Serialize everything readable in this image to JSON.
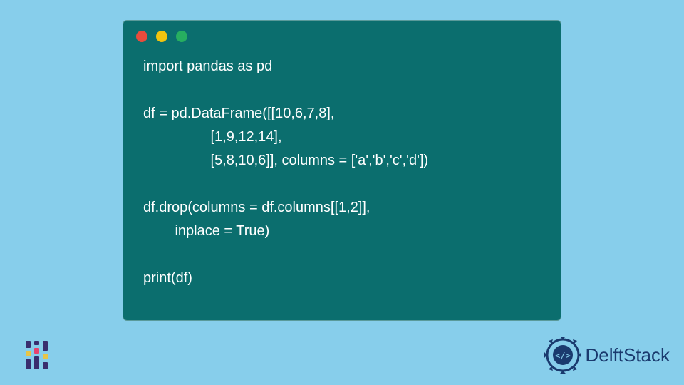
{
  "code": {
    "line1": "import pandas as pd",
    "line2": "",
    "line3": "df = pd.DataFrame([[10,6,7,8],",
    "line4": "                 [1,9,12,14],",
    "line5": "                 [5,8,10,6]], columns = ['a','b','c','d'])",
    "line6": "",
    "line7": "df.drop(columns = df.columns[[1,2]],",
    "line8": "        inplace = True)",
    "line9": "",
    "line10": "print(df)"
  },
  "branding": {
    "right_text_prefix": "Delft",
    "right_text_suffix": "Stack"
  },
  "colors": {
    "background": "#87ceeb",
    "code_bg": "#0b6e6e",
    "code_text": "#ffffff",
    "dot_red": "#e74c3c",
    "dot_yellow": "#f1c40f",
    "dot_green": "#27ae60",
    "brand_blue": "#1a3a6e"
  }
}
